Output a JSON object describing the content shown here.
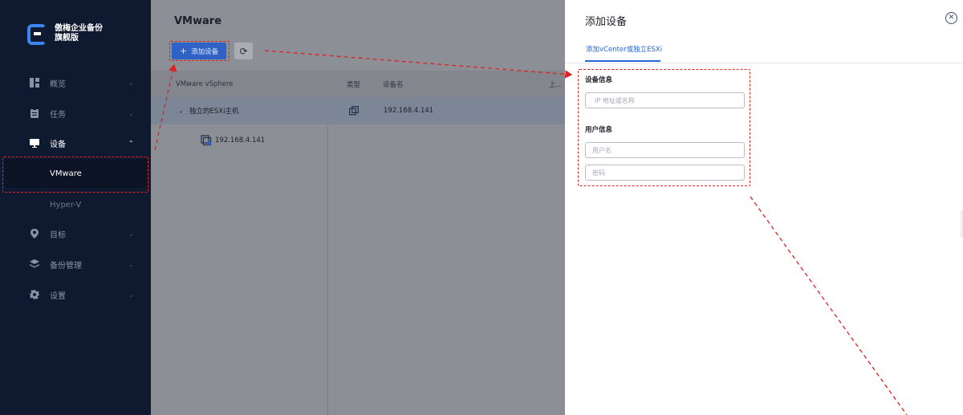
{
  "sidebar": {
    "brand_line1": "傲梅企业备份",
    "brand_line2": "旗舰版",
    "items": [
      {
        "label": "概览"
      },
      {
        "label": "任务"
      },
      {
        "label": "设备"
      },
      {
        "label": "目标"
      },
      {
        "label": "备份管理"
      },
      {
        "label": "设置"
      }
    ],
    "sub_items": [
      {
        "label": "VMware"
      },
      {
        "label": "Hyper-V"
      }
    ]
  },
  "main": {
    "title": "VMware",
    "add_button_label": "添加设备",
    "table": {
      "columns": [
        "VMware vSphere",
        "类型",
        "设备名",
        "上..."
      ],
      "group_row": {
        "name": "独立的ESXi主机",
        "device": "192.168.4.141"
      },
      "child_row": {
        "name": "192.168.4.141"
      }
    }
  },
  "drawer": {
    "title": "添加设备",
    "tab_label": "添加vCenter或独立ESXi",
    "device_section": "设备信息",
    "ip_placeholder": "IP 地址或名称",
    "user_section": "用户信息",
    "username_placeholder": "用户名",
    "password_placeholder": "密码"
  },
  "colors": {
    "sidebar_bg": "#0f1a31",
    "accent": "#2866d9",
    "annotation": "#e02121"
  }
}
